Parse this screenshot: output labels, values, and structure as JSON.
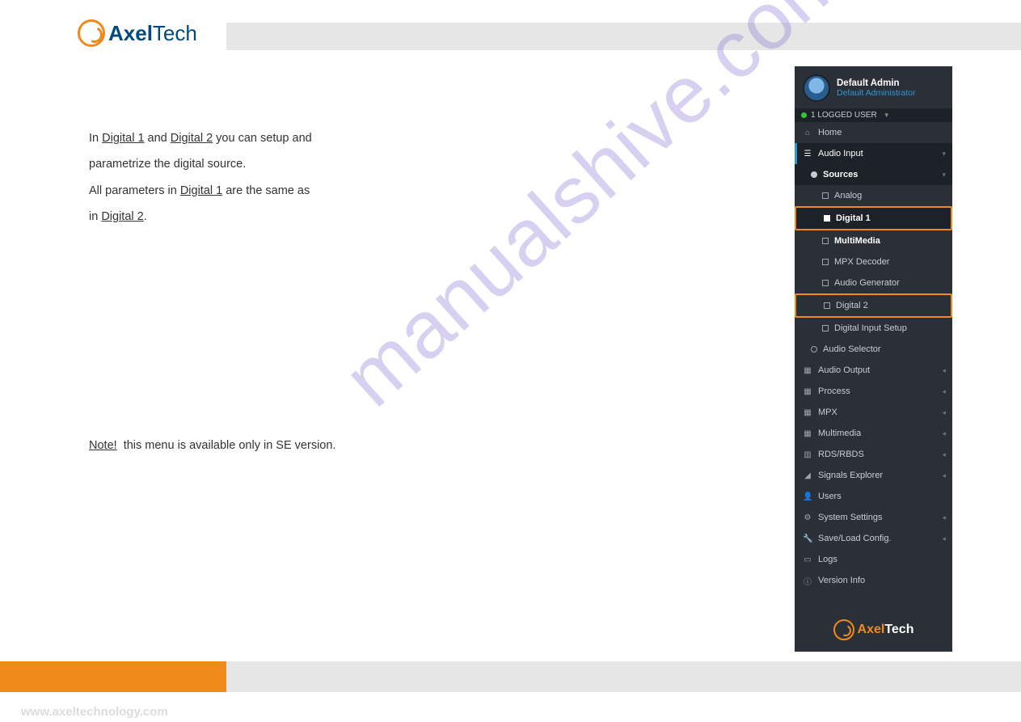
{
  "header": {
    "brand_axel": "Axel",
    "brand_tech": "Tech"
  },
  "content": {
    "p1a": "In ",
    "p1b": "Digital 1",
    "p1c": " and ",
    "p1d": "Digital 2",
    "p1e": " you can setup and",
    "p2": "parametrize the digital source.",
    "p3a": "All parameters in ",
    "p3b": "Digital 1",
    "p3c": " are the same as",
    "p4a": "in ",
    "p4b": "Digital 2",
    "p4c": ".",
    "note_label": "Note!",
    "note_rest": " this menu is available only in SE version."
  },
  "panel": {
    "user_name": "Default Admin",
    "user_role": "Default Administrator",
    "logged": "1 LOGGED USER",
    "home": "Home",
    "audio_input": "Audio Input",
    "sources": "Sources",
    "analog": "Analog",
    "digital1": "Digital 1",
    "multimedia": "MultiMedia",
    "mpx_decoder": "MPX Decoder",
    "audio_gen": "Audio Generator",
    "digital2": "Digital 2",
    "digital_input_setup": "Digital Input Setup",
    "audio_selector": "Audio Selector",
    "audio_output": "Audio Output",
    "process": "Process",
    "mpx": "MPX",
    "multimedia2": "Multimedia",
    "rds": "RDS/RBDS",
    "signals": "Signals Explorer",
    "users": "Users",
    "system_settings": "System Settings",
    "save_load": "Save/Load Config.",
    "logs": "Logs",
    "version": "Version Info",
    "brand_a": "Axel",
    "brand_t": "Tech"
  },
  "watermark": "manualshive.com",
  "footer": {
    "url": "www.axeltechnology.com"
  }
}
